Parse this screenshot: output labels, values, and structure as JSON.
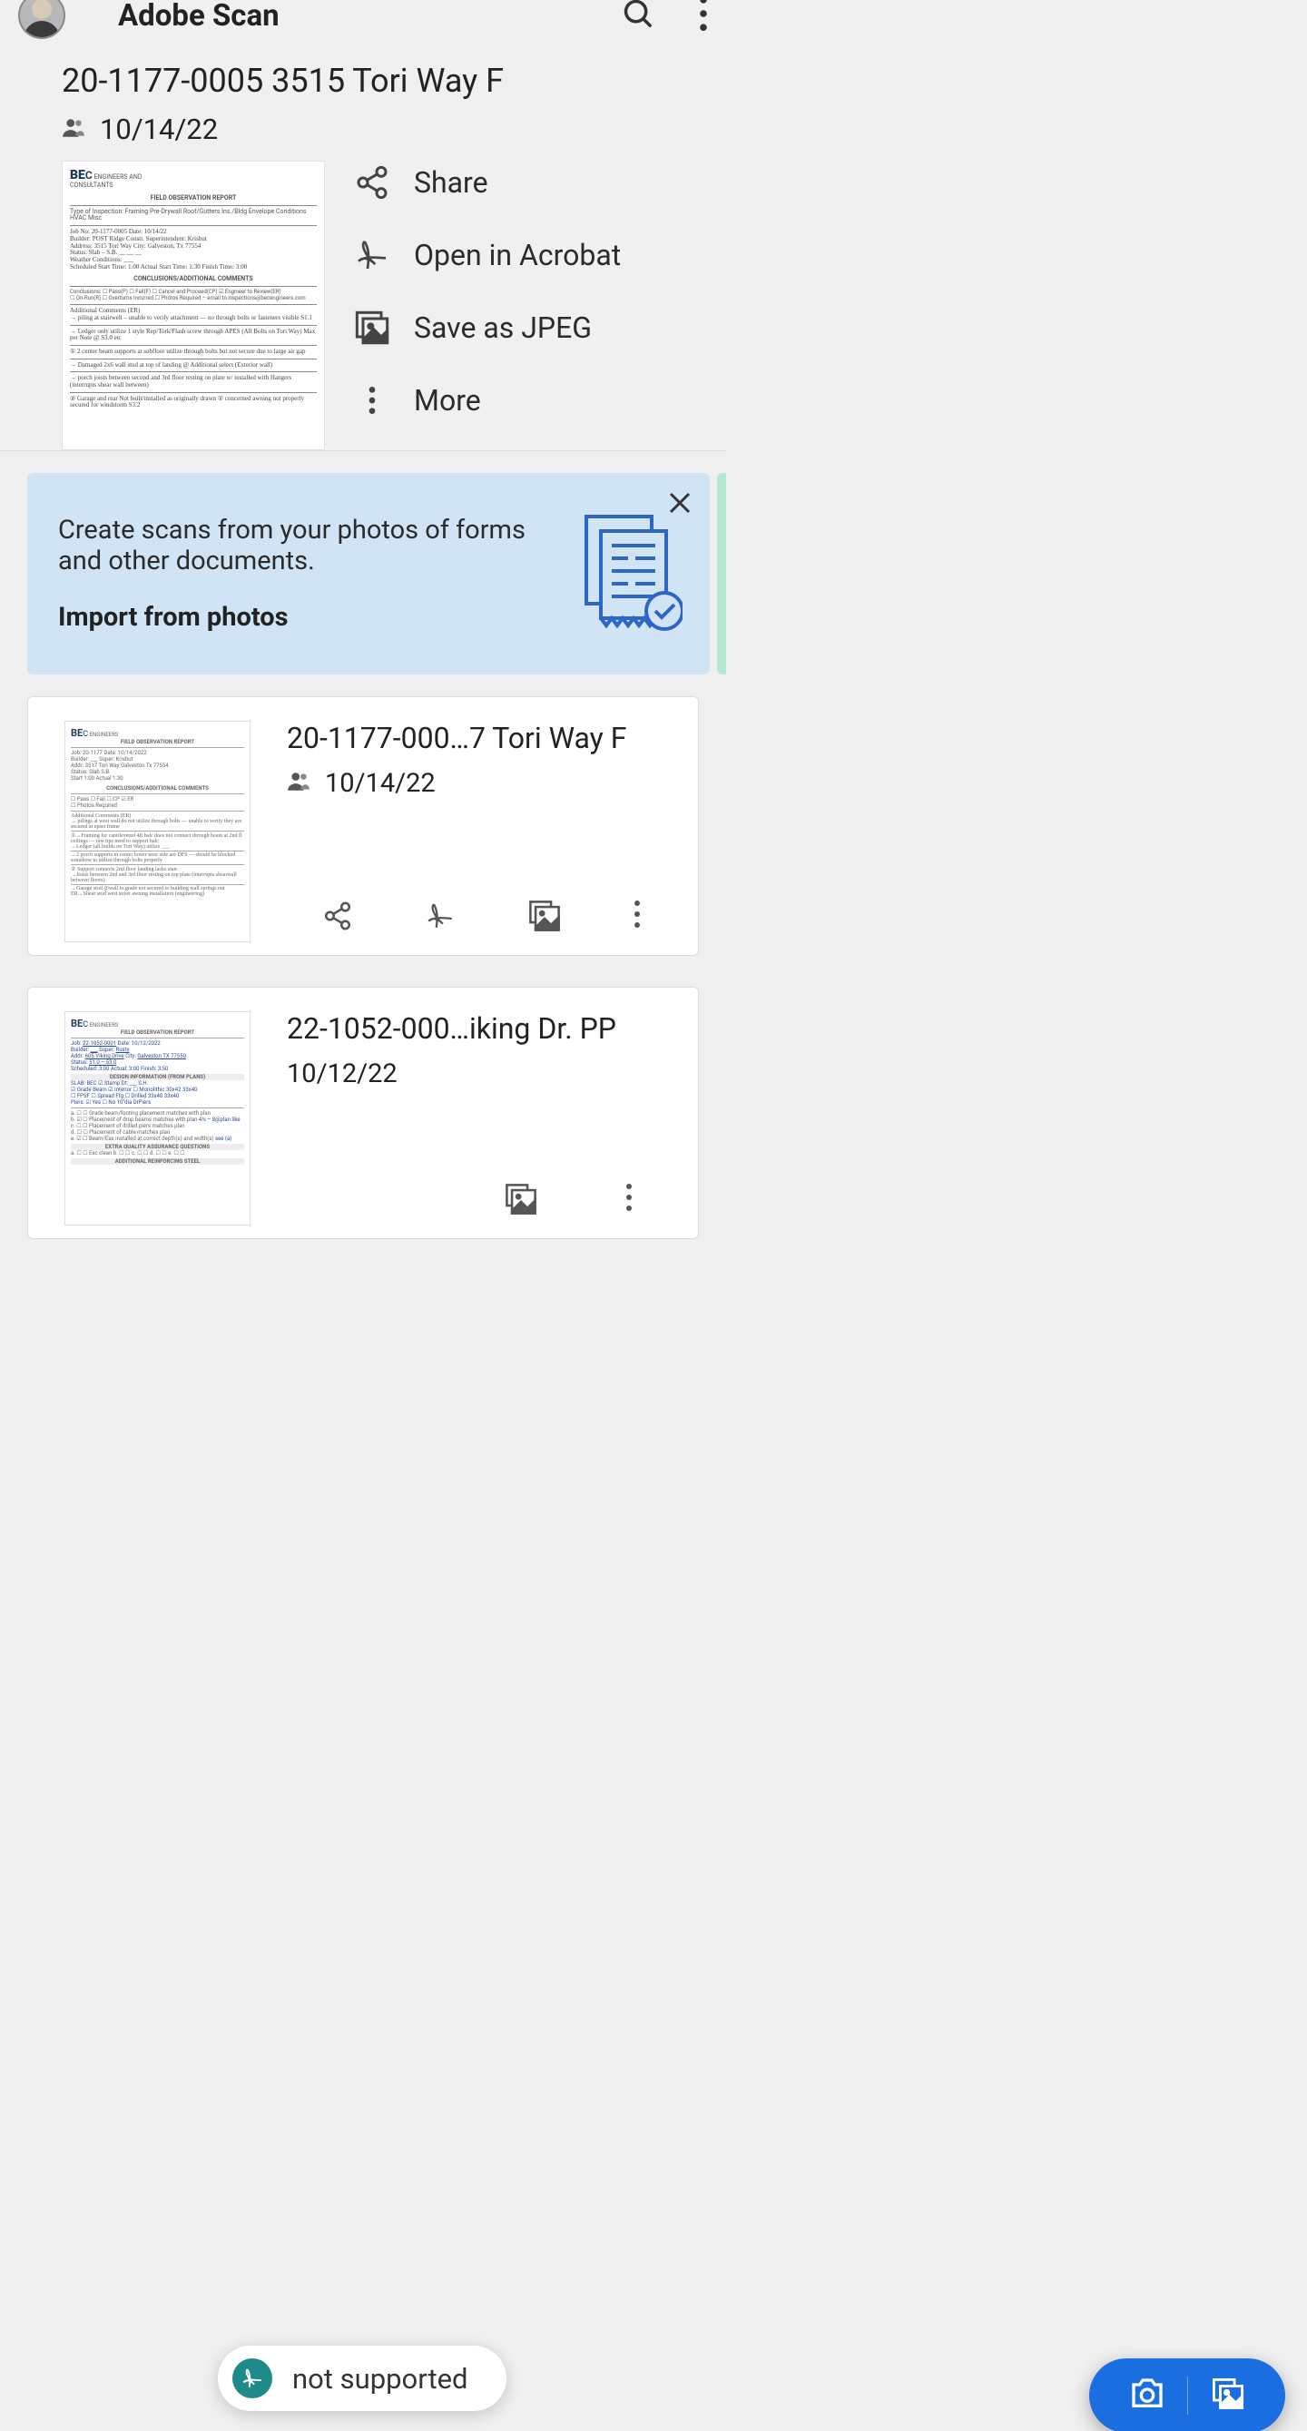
{
  "app": {
    "title": "Adobe Scan"
  },
  "featured": {
    "title": "20-1177-0005 3515 Tori Way F",
    "date": "10/14/22",
    "actions": {
      "share": "Share",
      "open": "Open in Acrobat",
      "save": "Save as JPEG",
      "more": "More"
    }
  },
  "promo": {
    "text": "Create scans from your photos of forms and other documents.",
    "link": "Import from photos"
  },
  "cards": [
    {
      "title": "20-1177-000…7 Tori Way F",
      "date": "10/14/22",
      "shared": true
    },
    {
      "title": "22-1052-000…iking Dr. PP",
      "date": "10/12/22",
      "shared": false
    }
  ],
  "toast": {
    "text": "not supported"
  }
}
